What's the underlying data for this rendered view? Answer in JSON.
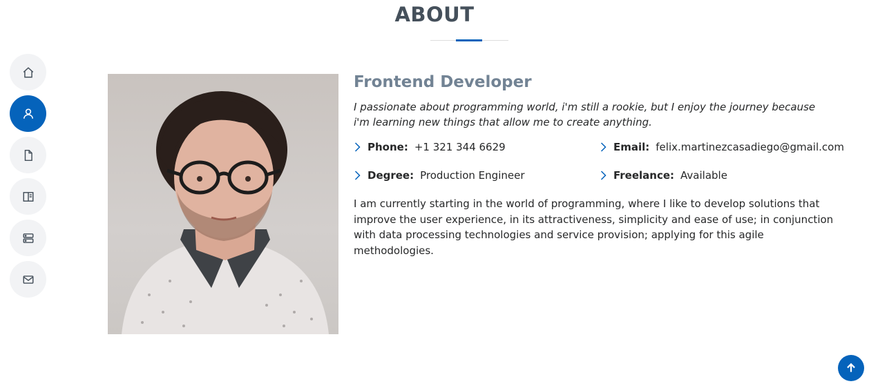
{
  "nav": {
    "items": [
      {
        "icon": "home-icon",
        "active": false
      },
      {
        "icon": "person-icon",
        "active": true
      },
      {
        "icon": "file-icon",
        "active": false
      },
      {
        "icon": "book-icon",
        "active": false
      },
      {
        "icon": "server-icon",
        "active": false
      },
      {
        "icon": "envelope-icon",
        "active": false
      }
    ]
  },
  "section": {
    "title": "ABOUT"
  },
  "profile": {
    "photo_alt": "Portrait photo",
    "role": "Frontend Developer",
    "lead": "I passionate about programming world, i'm still a rookie, but I enjoy the journey because i'm learning new things that allow me to create anything.",
    "info": [
      {
        "label": "Phone:",
        "value": "+1 321 344 6629"
      },
      {
        "label": "Email:",
        "value": "felix.martinezcasadiego@gmail.com"
      },
      {
        "label": "Degree:",
        "value": "Production Engineer"
      },
      {
        "label": "Freelance:",
        "value": "Available"
      }
    ],
    "description": "I am currently starting in the world of programming, where I like to develop solutions that improve the user experience, in its attractiveness, simplicity and ease of use; in conjunction with data processing technologies and service provision; applying for this agile methodologies."
  },
  "colors": {
    "accent": "#0563bb",
    "heading": "#45505b",
    "subheading": "#728394"
  },
  "back_to_top": {
    "icon": "arrow-up-icon"
  }
}
